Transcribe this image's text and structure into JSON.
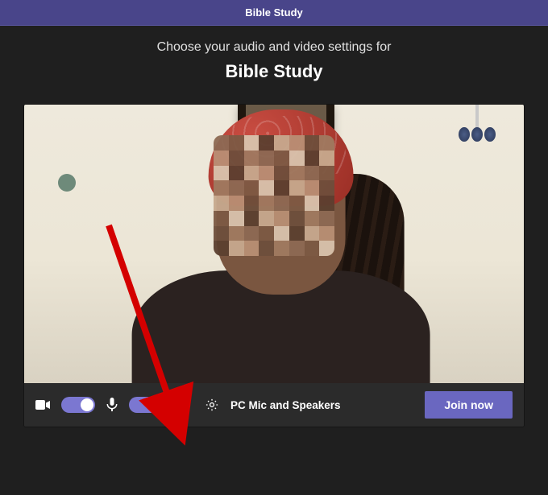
{
  "titlebar": {
    "title": "Bible Study"
  },
  "intro": {
    "line": "Choose your audio and video settings for",
    "meeting_name": "Bible Study"
  },
  "controls": {
    "camera": {
      "icon": "camera-icon",
      "on": true
    },
    "mic": {
      "icon": "mic-icon",
      "on": true
    },
    "blur": {
      "icon": "blur-icon"
    },
    "settings": {
      "icon": "gear-icon"
    },
    "device_label": "PC Mic and Speakers",
    "join_label": "Join now"
  },
  "colors": {
    "accent": "#6a67c0",
    "toggle": "#7b77d1",
    "titlebar": "#49458a",
    "arrow": "#d40000"
  }
}
